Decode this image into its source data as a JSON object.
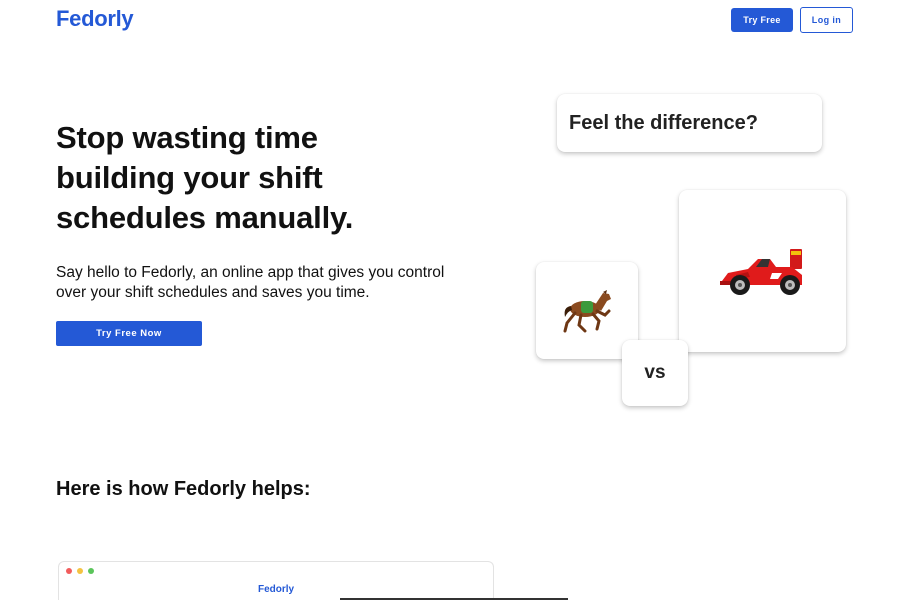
{
  "header": {
    "logo": "Fedorly",
    "try_free_label": "Try Free",
    "login_label": "Log in"
  },
  "hero": {
    "title": "Stop wasting time building your shift schedules manually.",
    "subtitle": "Say hello to Fedorly, an online app that gives you control over your shift schedules and saves you time.",
    "cta_label": "Try Free Now"
  },
  "comparison": {
    "question": "Feel the difference?",
    "left_icon": "horse-icon",
    "right_icon": "race-car-icon",
    "vs_label": "vs"
  },
  "how_it_helps": {
    "title": "Here is how Fedorly helps:"
  },
  "preview": {
    "brand": "Fedorly",
    "window_dots": [
      "#f25c5c",
      "#f4c342",
      "#5bc55b"
    ]
  },
  "colors": {
    "brand": "#2459d6",
    "text": "#111111"
  }
}
